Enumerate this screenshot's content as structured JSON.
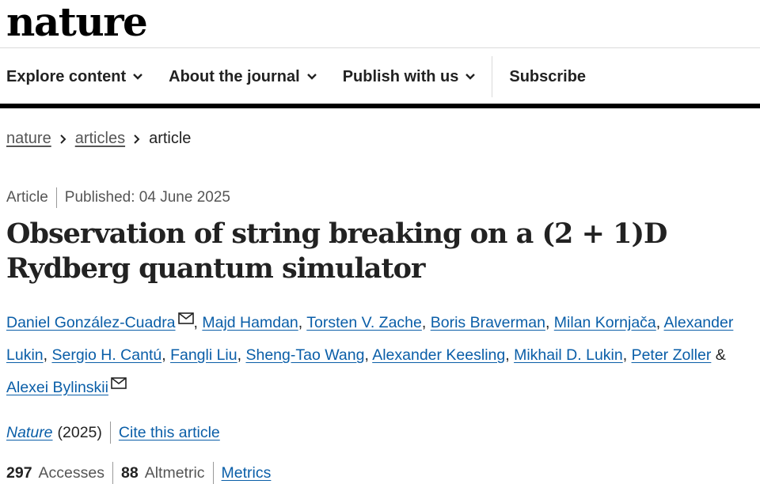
{
  "header": {
    "logo": "nature"
  },
  "nav": {
    "items": [
      {
        "label": "Explore content"
      },
      {
        "label": "About the journal"
      },
      {
        "label": "Publish with us"
      }
    ],
    "subscribe": "Subscribe"
  },
  "breadcrumb": {
    "items": [
      "nature",
      "articles"
    ],
    "current": "article"
  },
  "article": {
    "type": "Article",
    "published": "Published: 04 June 2025",
    "title": "Observation of string breaking on a (2 + 1)D Rydberg quantum simulator",
    "authors": [
      "Daniel González-Cuadra",
      "Majd Hamdan",
      "Torsten V. Zache",
      "Boris Braverman",
      "Milan Kornjača",
      "Alexander Lukin",
      "Sergio H. Cantú",
      "Fangli Liu",
      "Sheng-Tao Wang",
      "Alexander Keesling",
      "Mikhail D. Lukin",
      "Peter Zoller",
      "Alexei Bylinskii"
    ],
    "ampersand": "&",
    "journal": "Nature",
    "year": "(2025)",
    "cite": "Cite this article",
    "accesses_count": "297",
    "accesses_label": "Accesses",
    "altmetric_count": "88",
    "altmetric_label": "Altmetric",
    "metrics": "Metrics"
  }
}
